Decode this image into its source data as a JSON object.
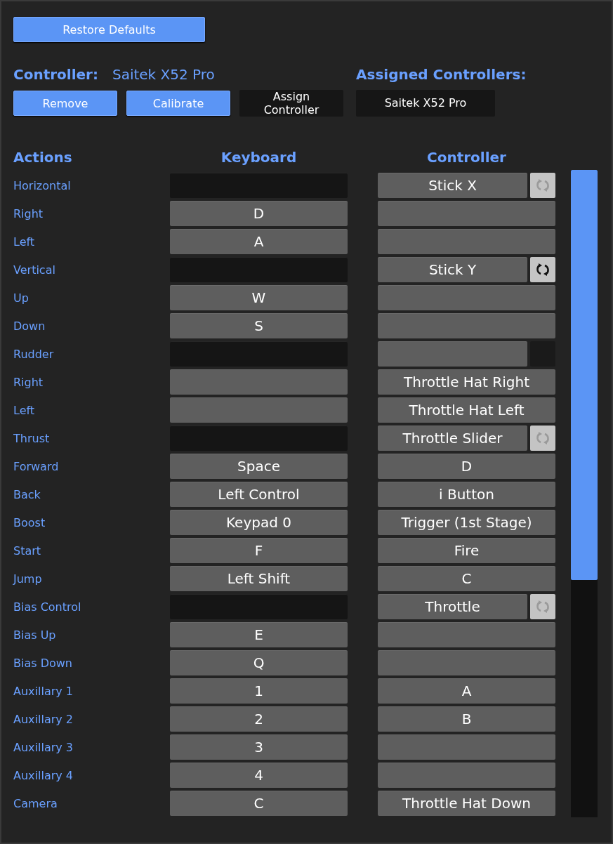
{
  "restore_button": "Restore Defaults",
  "controller": {
    "label": "Controller:",
    "name": "Saitek X52 Pro",
    "buttons": [
      {
        "label": "Remove",
        "kind": "primary"
      },
      {
        "label": "Calibrate",
        "kind": "primary"
      },
      {
        "label": "Assign Controller",
        "kind": "dark"
      }
    ]
  },
  "assigned": {
    "label": "Assigned Controllers:",
    "items": [
      "Saitek X52 Pro"
    ]
  },
  "columns": [
    "Actions",
    "Keyboard",
    "Controller"
  ],
  "rows": [
    {
      "kind": "axis",
      "action": "Horizontal",
      "controller": "Stick X",
      "inverted": false
    },
    {
      "kind": "button",
      "action": "Right",
      "keyboard": "D"
    },
    {
      "kind": "button",
      "action": "Left",
      "keyboard": "A"
    },
    {
      "kind": "axis",
      "action": "Vertical",
      "controller": "Stick Y",
      "inverted": true
    },
    {
      "kind": "button",
      "action": "Up",
      "keyboard": "W"
    },
    {
      "kind": "button",
      "action": "Down",
      "keyboard": "S"
    },
    {
      "kind": "axis",
      "action": "Rudder"
    },
    {
      "kind": "button",
      "action": "Right",
      "controller": "Throttle Hat Right"
    },
    {
      "kind": "button",
      "action": "Left",
      "controller": "Throttle Hat Left"
    },
    {
      "kind": "axis",
      "action": "Thrust",
      "controller": "Throttle Slider",
      "inverted": false
    },
    {
      "kind": "button",
      "action": "Forward",
      "keyboard": "Space",
      "controller": "D"
    },
    {
      "kind": "button",
      "action": "Back",
      "keyboard": "Left Control",
      "controller": "i Button"
    },
    {
      "kind": "button",
      "action": "Boost",
      "keyboard": "Keypad 0",
      "controller": "Trigger (1st Stage)"
    },
    {
      "kind": "button",
      "action": "Start",
      "keyboard": "F",
      "controller": "Fire"
    },
    {
      "kind": "button",
      "action": "Jump",
      "keyboard": "Left Shift",
      "controller": "C"
    },
    {
      "kind": "axis",
      "action": "Bias Control",
      "controller": "Throttle",
      "inverted": false
    },
    {
      "kind": "button",
      "action": "Bias Up",
      "keyboard": "E"
    },
    {
      "kind": "button",
      "action": "Bias Down",
      "keyboard": "Q"
    },
    {
      "kind": "button",
      "action": "Auxillary 1",
      "keyboard": "1",
      "controller": "A"
    },
    {
      "kind": "button",
      "action": "Auxillary 2",
      "keyboard": "2",
      "controller": "B"
    },
    {
      "kind": "button",
      "action": "Auxillary 3",
      "keyboard": "3"
    },
    {
      "kind": "button",
      "action": "Auxillary 4",
      "keyboard": "4"
    },
    {
      "kind": "button",
      "action": "Camera",
      "keyboard": "C",
      "controller": "Throttle Hat Down"
    }
  ]
}
